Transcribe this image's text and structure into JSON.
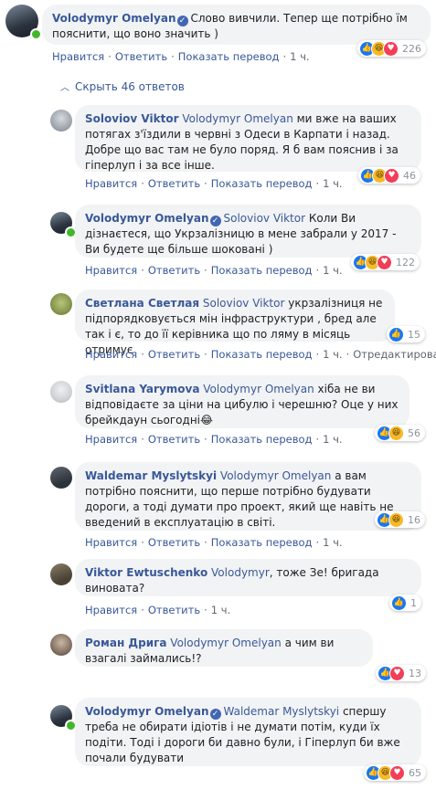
{
  "top_comment": {
    "author": "Volodymyr Omelyan",
    "text": "Слово вивчили. Тепер ще потрібно їм пояснити, що воно значить )",
    "reactions": [
      "like",
      "haha",
      "love"
    ],
    "count": "226",
    "time": "1 ч."
  },
  "actions": {
    "like": "Нравится",
    "reply": "Ответить",
    "translate": "Показать перевод",
    "edited": "Отредактировано"
  },
  "hide_replies": "Скрыть 46 ответов",
  "replies": [
    {
      "author": "Soloviov Viktor",
      "verified": false,
      "line1": "Volodymyr Omelyan ми вже на ваших",
      "mention": "Volodymyr Omelyan",
      "text": " ми вже на ваших потягах з'їздили в червні з Одеси в Карпати і назад. Добре що вас там не було поряд. Я б вам пояснив і за гіперлуп і за все інше.",
      "reactions": [
        "like",
        "haha",
        "love"
      ],
      "count": "46",
      "time": "1 ч.",
      "edited": false
    },
    {
      "author": "Volodymyr Omelyan",
      "verified": true,
      "mention": "Soloviov Viktor",
      "text": " Коли Ви дізнаєтеся, що Укрзалізницю в мене забрали у 2017 - Ви будете ще більше шоковані )",
      "reactions": [
        "like",
        "haha",
        "love"
      ],
      "count": "122",
      "time": "1 ч.",
      "edited": false
    },
    {
      "author": "Светлана Светлая",
      "verified": false,
      "mention": "Soloviov Viktor",
      "text": " укрзалізниця не підпорядковується мін інфраструктури , бред але так і є, то до її керівника що по ляму в місяць отримує",
      "reactions": [
        "like"
      ],
      "count": "15",
      "time": "1 ч.",
      "edited": true
    },
    {
      "author": "Svitlana Yarymova",
      "verified": false,
      "mention": "Volodymyr Omelyan",
      "text": " хіба не ви відповідаєте за ціни на цибулю і черешню? Оце у них брейкдаун сьогодні😂",
      "reactions": [
        "like",
        "haha"
      ],
      "count": "56",
      "time": "1 ч.",
      "edited": false
    },
    {
      "author": "Waldemar Myslytskyi",
      "verified": false,
      "mention": "Volodymyr Omelyan",
      "text": " а вам потрібно пояснити, що перше потрібно будувати дороги, а тоді думати про проект, який ще навіть не введений в експлуатацію в світі.",
      "reactions": [
        "like",
        "haha"
      ],
      "count": "16",
      "time": "1 ч.",
      "edited": false
    },
    {
      "author": "Viktor Ewtuschenko",
      "verified": false,
      "mention": "Volodymyr",
      "text": ", тоже Зе! бригада виновата?",
      "reactions": [
        "like"
      ],
      "count": "1",
      "time": "1 ч.",
      "edited": false
    },
    {
      "author": "Роман Дрига",
      "verified": false,
      "mention": "Volodymyr Omelyan",
      "text": " а чим ви взагалі займались!?",
      "reactions": [
        "like",
        "love"
      ],
      "count": "13",
      "time": "",
      "edited": false
    },
    {
      "author": "Volodymyr Omelyan",
      "verified": true,
      "mention": "Waldemar Myslytskyi",
      "text": " спершу треба не обирати ідіотів і не думати потім, куди їх подіти. Тоді і дороги би давно були, і Гіперлуп би вже почали будувати",
      "reactions": [
        "like",
        "haha",
        "love"
      ],
      "count": "65",
      "time": "",
      "edited": false
    }
  ],
  "colors": {
    "link": "#385898",
    "bubble": "#f2f3f5",
    "like": "#1877f2",
    "haha": "#f7b928",
    "love": "#f33e58",
    "online": "#42b72a"
  }
}
